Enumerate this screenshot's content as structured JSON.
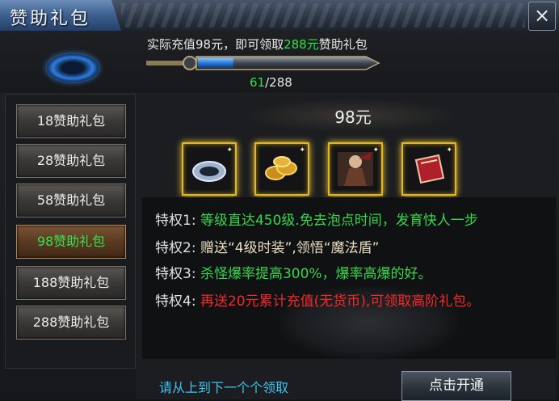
{
  "window": {
    "title": "赞助礼包",
    "close_glyph": "×"
  },
  "header": {
    "recharge_prefix": "实际充值98元，即可领取",
    "recharge_highlight": "288元",
    "recharge_suffix": "赞助礼包",
    "progress_current": "61",
    "progress_total": "/288",
    "progress_fraction": 0.212,
    "orb_icon": "blue-ring-orb-icon",
    "sword_icon": "sword-progress-bar"
  },
  "nav": {
    "items": [
      {
        "label": "18赞助礼包",
        "active": false
      },
      {
        "label": "28赞助礼包",
        "active": false
      },
      {
        "label": "58赞助礼包",
        "active": false
      },
      {
        "label": "98赞助礼包",
        "active": true
      },
      {
        "label": "188赞助礼包",
        "active": false
      },
      {
        "label": "288赞助礼包",
        "active": false
      }
    ]
  },
  "package": {
    "price": "98元",
    "items": [
      {
        "icon": "silver-ring-icon"
      },
      {
        "icon": "gold-coins-icon"
      },
      {
        "icon": "warrior-fashion-icon"
      },
      {
        "icon": "red-book-icon"
      }
    ]
  },
  "perks": [
    {
      "label": "特权1:",
      "text": "等级直达450级.免去泡点时间，发育快人一步",
      "color": "#38e04f"
    },
    {
      "label": "特权2:",
      "text": "赠送“4级时装”,领悟“魔法盾”",
      "color": "#f3e8c8"
    },
    {
      "label": "特权3:",
      "text": "杀怪爆率提高300%，爆率高爆的好。",
      "color": "#38e04f"
    },
    {
      "label": "特权4:",
      "text": "再送20元累计充值(无货币),可领取高阶礼包。",
      "color": "#ff2a2a"
    }
  ],
  "footer": {
    "hint": "请从上到下一个个领取",
    "open_button": "点击开通"
  },
  "colors": {
    "highlight_green": "#31e04a",
    "hint_blue": "#3dc4f2",
    "gold_frame": "#e2b62b",
    "active_tab": "#5a3a22"
  }
}
